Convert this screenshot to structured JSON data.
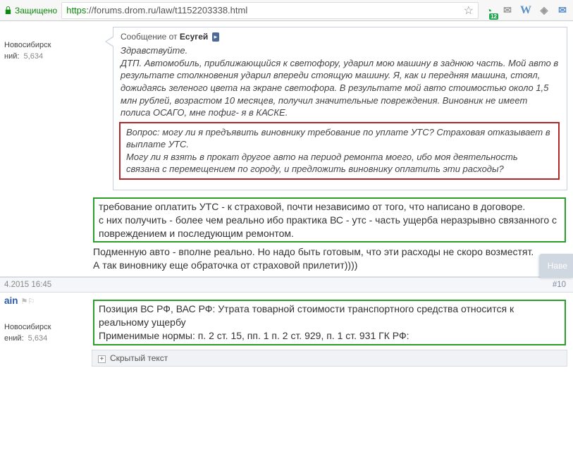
{
  "browser": {
    "secure_label": "Защищено",
    "url_scheme": "https",
    "url_rest": "://forums.drom.ru/law/t1152203338.html",
    "ext_badge": "12"
  },
  "post1": {
    "city": "Новосибирск",
    "msg_label": "ний:",
    "msg_count": "5,634",
    "quote_prefix": "Сообщение от",
    "quote_author": "Есугей",
    "quote_jump": "▸",
    "quote_greeting": "Здравствуйте.",
    "quote_p1": "ДТП. Автомобиль, приближающийся к светофору, ударил мою машину в заднюю часть. Мой авто в результате столкновения ударил впереди стоящую машину. Я, как и передняя машина, стоял, дожидаясь зеленого цвета на экране светофора. В результате мой авто стоимостью около 1,5 млн рублей, возрастом 10 месяцев, получил значительные повреждения. Виновник не имеет полиса ОСАГО, мне пофиг- я в КАСКЕ.",
    "quote_red1": "Вопрос: могу ли я предъявить виновнику требование по уплате УТС? Страховая отказывает в выплате УТС.",
    "quote_red2": "Могу ли я взять в прокат другое авто на период ремонта моего, ибо моя деятельность связана с перемещением по городу, и предложить виновнику оплатить эти расходы?",
    "reply_g1": "требование оплатить УТС - к страховой, почти независимо от того, что написано в договоре.",
    "reply_g2": "с них получить - более чем реально ибо практика ВС - утс - часть ущерба неразрывно связанного с повреждением и последующим ремонтом.",
    "reply_p1": "Подменную авто - вполне реально. Но надо быть готовым, что эти расходы не скоро возместят.",
    "reply_p2": "А так виновнику еще обраточка от страховой прилетит))))",
    "hover_btn": "Наве"
  },
  "post2": {
    "date": "4.2015 16:45",
    "num": "#10",
    "username": "ain",
    "city": "Новосибирск",
    "msg_label": "ений:",
    "msg_count": "5,634",
    "reply_g1": "Позиция ВС РФ, ВАС РФ: Утрата товарной стоимости транспортного средства относится к реальному ущербу",
    "reply_g2": "Применимые нормы: п. 2 ст. 15, пп. 1 п. 2 ст. 929, п. 1 ст. 931 ГК РФ:",
    "spoiler": "Скрытый текст"
  }
}
